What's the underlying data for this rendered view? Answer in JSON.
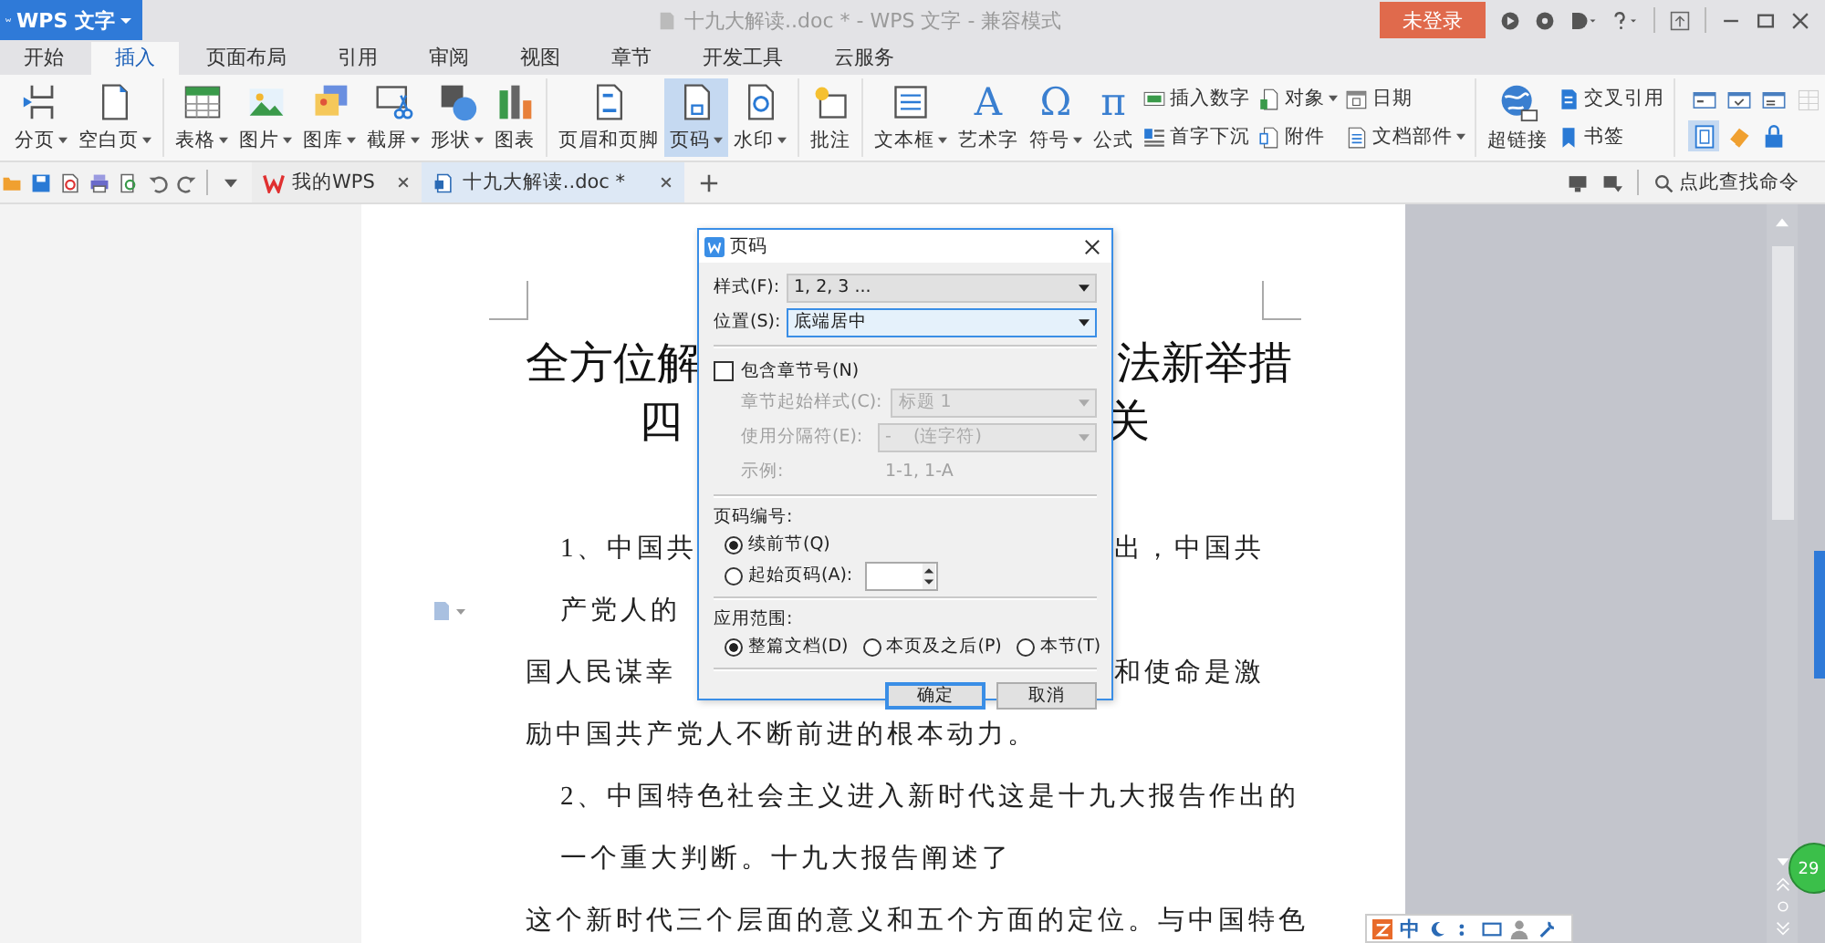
{
  "title_bar": {
    "app_menu": "WPS 文字",
    "title": "十九大解读..doc * - WPS 文字 - 兼容模式",
    "login_button": "未登录"
  },
  "ribbon_tabs": [
    {
      "label": "开始",
      "selected": false
    },
    {
      "label": "插入",
      "selected": true
    },
    {
      "label": "页面布局",
      "selected": false
    },
    {
      "label": "引用",
      "selected": false
    },
    {
      "label": "审阅",
      "selected": false
    },
    {
      "label": "视图",
      "selected": false
    },
    {
      "label": "章节",
      "selected": false
    },
    {
      "label": "开发工具",
      "selected": false
    },
    {
      "label": "云服务",
      "selected": false
    }
  ],
  "ribbon": {
    "groups": [
      {
        "items": [
          {
            "kind": "large",
            "label": "分页",
            "dropdown": true,
            "selected": false
          },
          {
            "kind": "large",
            "label": "空白页",
            "dropdown": true,
            "selected": false
          }
        ]
      },
      {
        "items": [
          {
            "kind": "large",
            "label": "表格",
            "dropdown": true,
            "selected": false
          },
          {
            "kind": "large",
            "label": "图片",
            "dropdown": true,
            "selected": false
          },
          {
            "kind": "large",
            "label": "图库",
            "dropdown": true,
            "selected": false
          },
          {
            "kind": "large",
            "label": "截屏",
            "dropdown": true,
            "selected": false
          },
          {
            "kind": "large",
            "label": "形状",
            "dropdown": true,
            "selected": false
          },
          {
            "kind": "large",
            "label": "图表",
            "dropdown": false,
            "selected": false
          }
        ]
      },
      {
        "items": [
          {
            "kind": "large",
            "label": "页眉和页脚",
            "dropdown": false,
            "selected": false
          },
          {
            "kind": "large",
            "label": "页码",
            "dropdown": true,
            "selected": true
          },
          {
            "kind": "large",
            "label": "水印",
            "dropdown": true,
            "selected": false
          }
        ]
      },
      {
        "items": [
          {
            "kind": "large",
            "label": "批注",
            "dropdown": false,
            "selected": false
          }
        ]
      },
      {
        "items": [
          {
            "kind": "large",
            "label": "文本框",
            "dropdown": true,
            "selected": false
          },
          {
            "kind": "glyph",
            "glyph": "A",
            "label": "艺术字",
            "dropdown": false,
            "selected": false
          },
          {
            "kind": "glyph",
            "glyph": "Ω",
            "label": "符号",
            "dropdown": true,
            "selected": false
          },
          {
            "kind": "glyph",
            "glyph": "π",
            "label": "公式",
            "dropdown": false,
            "selected": false
          },
          {
            "kind": "stack",
            "items": [
              {
                "label": "插入数字",
                "dropdown": false
              },
              {
                "label": "首字下沉",
                "dropdown": false
              }
            ]
          },
          {
            "kind": "stack",
            "items": [
              {
                "label": "对象",
                "dropdown": true
              },
              {
                "label": "附件",
                "dropdown": false
              }
            ]
          },
          {
            "kind": "stack",
            "items": [
              {
                "label": "日期",
                "dropdown": false
              },
              {
                "label": "文档部件",
                "dropdown": true
              }
            ]
          }
        ]
      },
      {
        "items": [
          {
            "kind": "large",
            "label": "超链接",
            "dropdown": false,
            "selected": false
          },
          {
            "kind": "stack",
            "items": [
              {
                "label": "交叉引用",
                "dropdown": false
              },
              {
                "label": "书签",
                "dropdown": false
              }
            ]
          }
        ]
      },
      {
        "items": [
          {
            "kind": "icons",
            "items": [
              {
                "selected": false,
                "disabled": false
              },
              {
                "selected": false,
                "disabled": false
              },
              {
                "selected": false,
                "disabled": false
              },
              {
                "selected": false,
                "disabled": true
              },
              {
                "selected": true,
                "disabled": false
              },
              {
                "selected": false,
                "disabled": false
              },
              {
                "selected": false,
                "disabled": false
              }
            ]
          }
        ]
      }
    ]
  },
  "quick_bar": {
    "doc_tabs": [
      {
        "label": "我的WPS",
        "selected": false
      },
      {
        "label": "十九大解读..doc *",
        "selected": true
      }
    ],
    "search": {
      "placeholder": "点此查找命令"
    }
  },
  "document": {
    "title_lines": [
      {
        "left": "全方位解",
        "right": "法新举措"
      },
      {
        "left": "四",
        "right": "关"
      }
    ],
    "lines": [
      {
        "kind": "indent",
        "left": "1、中国共",
        "right": "出，中国共"
      },
      {
        "kind": "indent",
        "left": "产党人的"
      },
      {
        "kind": "flush",
        "left": "国人民谋幸",
        "right": "和使命是激"
      },
      {
        "kind": "flush",
        "left": "励中国共产党人不断前进的根本动力。"
      },
      {
        "kind": "indent",
        "left": "2、中国特色社会主义进入新时代这是十九大报告作出的"
      },
      {
        "kind": "indent",
        "left": "一个重大判断。十九大报告阐述了"
      },
      {
        "kind": "flush",
        "left": "这个新时代三个层面的意义和五个方面的定位。与中国特色"
      }
    ]
  },
  "dialog": {
    "title": "页码",
    "selects": [
      {
        "label": "样式(F):",
        "value": "1, 2, 3 ...",
        "focused": false
      },
      {
        "label": "位置(S):",
        "value": "底端居中",
        "focused": true
      }
    ],
    "include_chapter": {
      "label": "包含章节号(N)",
      "checked": false
    },
    "chapter_fields": [
      {
        "label": "章节起始样式(C):",
        "value": "标题 1",
        "disabled": true
      },
      {
        "label": "使用分隔符(E):",
        "value": "-    (连字符)",
        "disabled": true
      }
    ],
    "example": {
      "label": "示例:",
      "value": "1-1, 1-A",
      "disabled": true
    },
    "numbering": {
      "heading": "页码编号:",
      "options": [
        {
          "label": "续前节(Q)",
          "selected": true
        },
        {
          "label": "起始页码(A):",
          "selected": false
        }
      ]
    },
    "scope": {
      "heading": "应用范围:",
      "options": [
        {
          "label": "整篇文档(D)",
          "selected": true
        },
        {
          "label": "本页及之后(P)",
          "selected": false
        },
        {
          "label": "本节(T)",
          "selected": false
        }
      ]
    },
    "buttons": [
      {
        "label": "确定",
        "primary": true
      },
      {
        "label": "取消",
        "primary": false
      }
    ]
  },
  "side_badge": "29",
  "ime_bar": {
    "label": "中"
  }
}
